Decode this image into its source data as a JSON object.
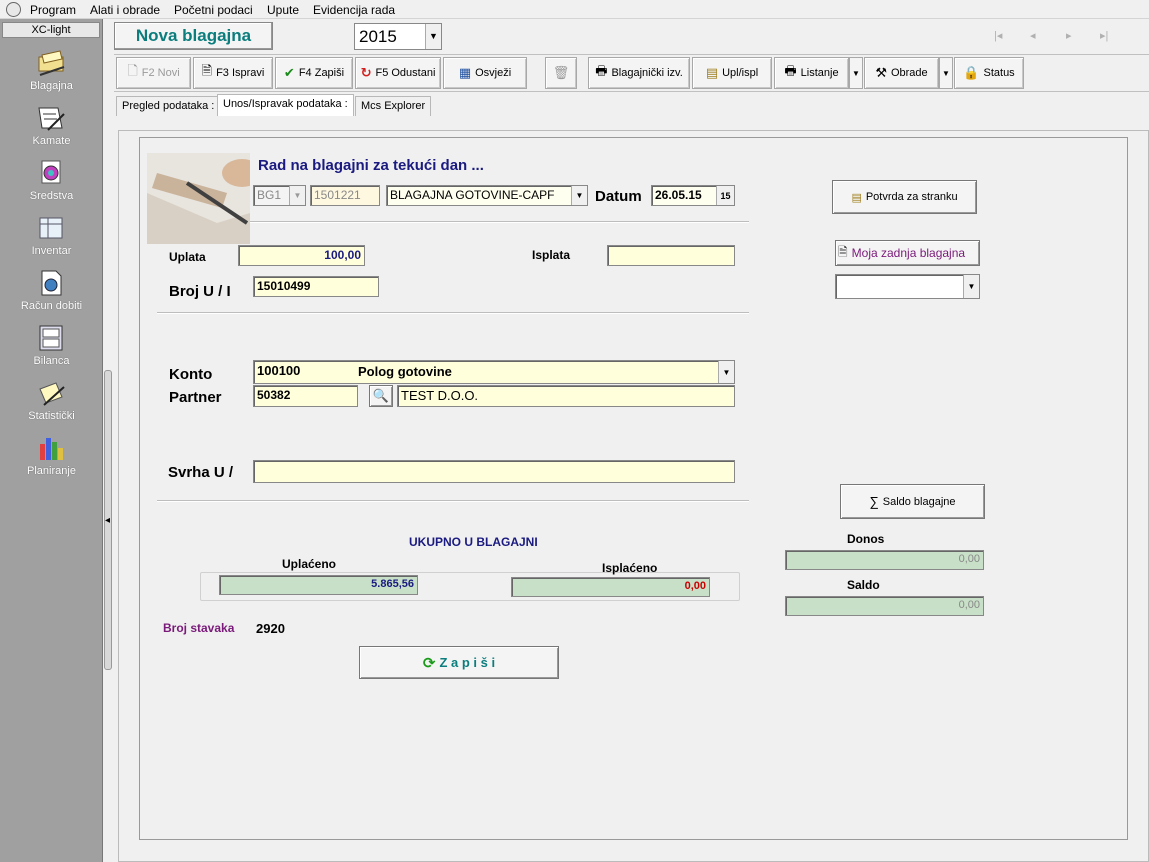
{
  "menu": [
    "Program",
    "Alati i obrade",
    "Početni podaci",
    "Upute",
    "Evidencija rada"
  ],
  "sidebar": {
    "title": "XC-light",
    "items": [
      {
        "label": "Blagajna",
        "icon": "cash-register-icon"
      },
      {
        "label": "Kamate",
        "icon": "interest-icon"
      },
      {
        "label": "Sredstva",
        "icon": "assets-icon"
      },
      {
        "label": "Inventar",
        "icon": "inventory-icon"
      },
      {
        "label": "Račun dobiti",
        "icon": "profit-account-icon"
      },
      {
        "label": "Bilanca",
        "icon": "balance-icon"
      },
      {
        "label": "Statistički",
        "icon": "statistics-icon"
      },
      {
        "label": "Planiranje",
        "icon": "planning-chart-icon"
      }
    ]
  },
  "header": {
    "title": "Nova blagajna",
    "year": "2015"
  },
  "toolbar": {
    "new": "F2 Novi",
    "edit": "F3 Ispravi",
    "save": "F4 Zapiši",
    "cancel": "F5 Odustani",
    "refresh": "Osvježi",
    "cash_report": "Blagajnički izv.",
    "in_out": "Upl/ispl",
    "listing": "Listanje",
    "processing": "Obrade",
    "status": "Status"
  },
  "tabs": [
    "Pregled podataka :",
    "Unos/Ispravak podataka :",
    "Mcs Explorer"
  ],
  "form": {
    "heading": "Rad na blagajni za tekući dan ...",
    "cashbox_code": "BG1",
    "cashbox_number": "1501221",
    "cashbox_name": "BLAGAJNA GOTOVINE-CAPF",
    "date_label": "Datum",
    "date_value": "26.05.15",
    "confirm_button": "Potvrda za stranku",
    "my_last_button": "Moja zadnja blagajna",
    "uplata_label": "Uplata",
    "uplata_value": "100,00",
    "isplata_label": "Isplata",
    "isplata_value": "",
    "broj_label": "Broj  U / I",
    "broj_value": "15010499",
    "konto_label": "Konto",
    "konto_code": "100100",
    "konto_name": "Polog gotovine",
    "partner_label": "Partner",
    "partner_code": "50382",
    "partner_name": "TEST   D.O.O.",
    "svrha_label": "Svrha U /",
    "svrha_value": "",
    "saldo_button": "Saldo blagajne",
    "total_heading": "UKUPNO U BLAGAJNI",
    "uplaceno_label": "Uplaćeno",
    "uplaceno_value": "5.865,56",
    "isplaceno_label": "Isplaćeno",
    "isplaceno_value": "0,00",
    "donos_label": "Donos",
    "donos_value": "0,00",
    "saldo_label": "Saldo",
    "saldo_value": "0,00",
    "broj_stavaka_label": "Broj stavaka",
    "broj_stavaka_value": "2920",
    "save_button": "Z a p i š i"
  },
  "colors": {
    "title_teal": "#0b7d7d",
    "heading_navy": "#1a1a80",
    "field_yellow": "#ffffdc",
    "field_green": "#c8e0c8",
    "negative_red": "#cc0000",
    "label_purple": "#7a1a7a"
  }
}
